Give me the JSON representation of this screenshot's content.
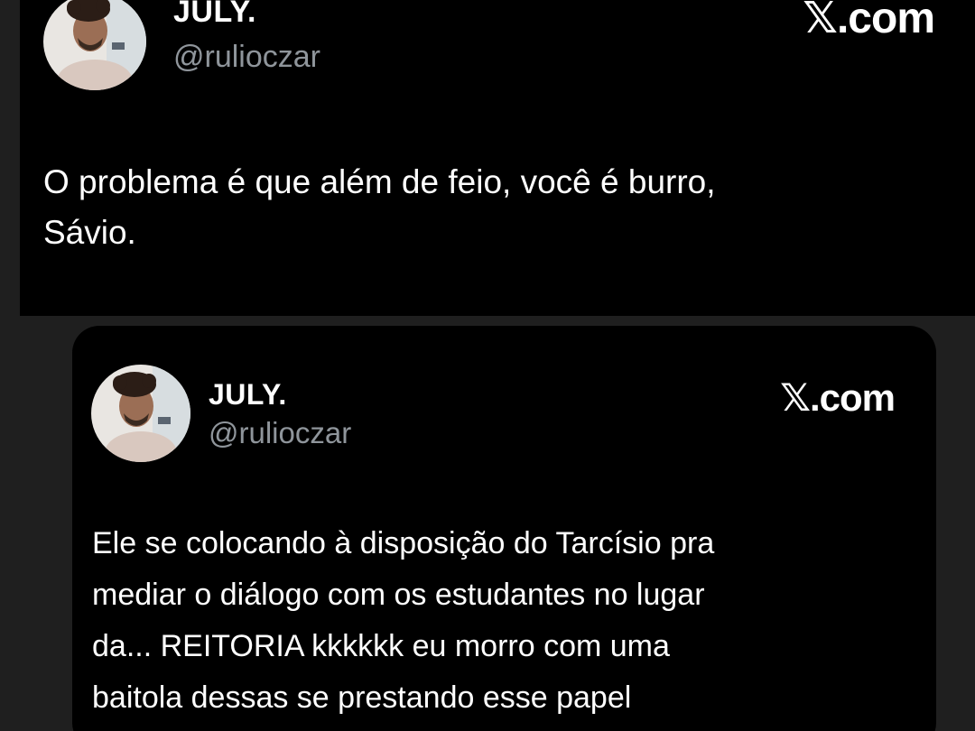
{
  "top_tweet": {
    "display_name": "JULY.",
    "handle": "@rulioczar",
    "brand": "𝕏.com",
    "text_lines": [
      "O problema é que além de feio, você é burro,",
      "Sávio."
    ]
  },
  "quoted_tweet": {
    "display_name": "JULY.",
    "handle": "@rulioczar",
    "brand": "𝕏.com",
    "text_lines": [
      "Ele se colocando à disposição do Tarcísio pra",
      "mediar o diálogo com os estudantes no lugar",
      "da... REITORIA kkkkkk eu morro com uma",
      "baitola dessas se prestando esse papel"
    ]
  },
  "icons": {
    "avatar": "profile-photo",
    "brand_logo": "x-logo"
  },
  "colors": {
    "background": "#1f1f1f",
    "card": "#000000",
    "text": "#ffffff",
    "muted": "#8f959b"
  }
}
